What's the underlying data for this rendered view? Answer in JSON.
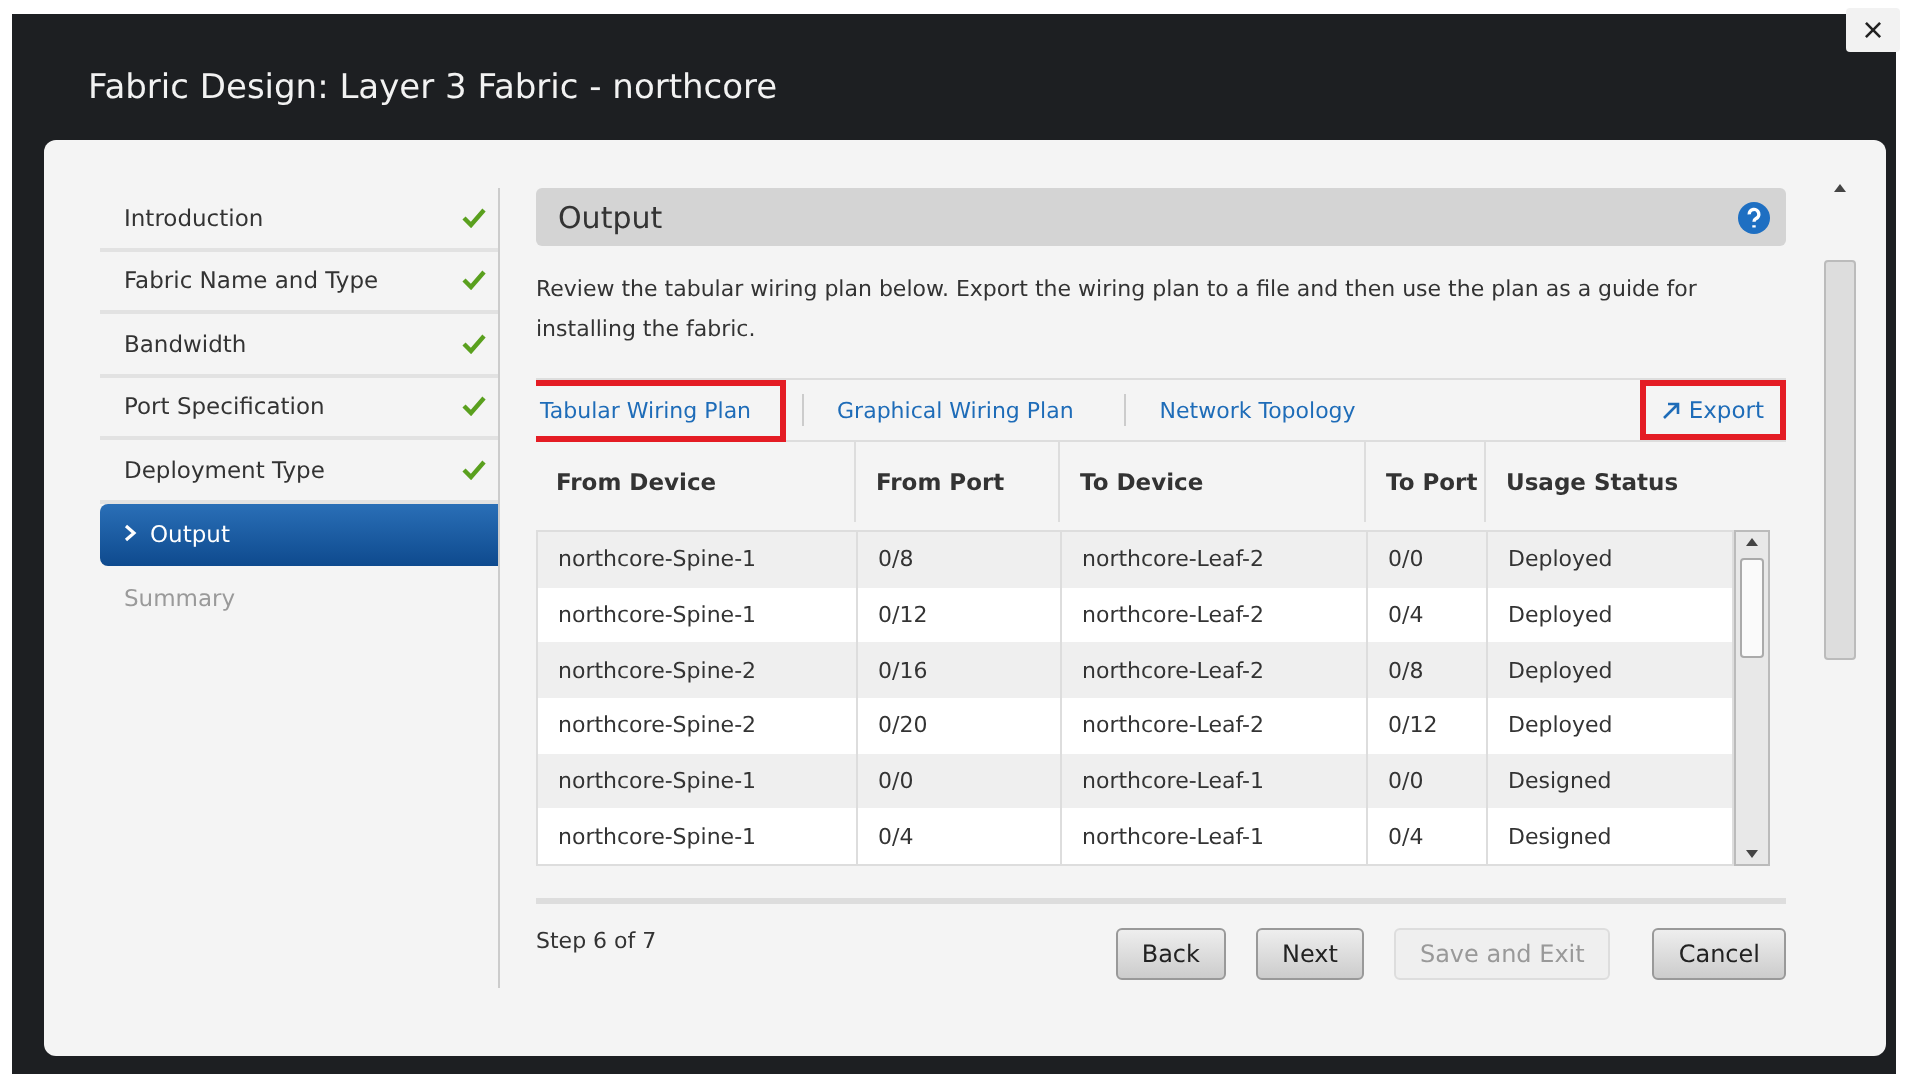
{
  "window": {
    "title": "Fabric Design: Layer 3 Fabric - northcore",
    "close": "×"
  },
  "sidebar": {
    "items": [
      {
        "label": "Introduction",
        "completed": true,
        "selected": false,
        "disabled": false
      },
      {
        "label": "Fabric Name and Type",
        "completed": true,
        "selected": false,
        "disabled": false
      },
      {
        "label": "Bandwidth",
        "completed": true,
        "selected": false,
        "disabled": false
      },
      {
        "label": "Port Specification",
        "completed": true,
        "selected": false,
        "disabled": false
      },
      {
        "label": "Deployment Type",
        "completed": true,
        "selected": false,
        "disabled": false
      },
      {
        "label": "Output",
        "completed": false,
        "selected": true,
        "disabled": false
      },
      {
        "label": "Summary",
        "completed": false,
        "selected": false,
        "disabled": true
      }
    ]
  },
  "section": {
    "title": "Output",
    "description": "Review the tabular wiring plan below. Export the wiring plan to a file and then use the plan as a guide for installing the fabric."
  },
  "tabs": [
    {
      "label": "Tabular Wiring Plan",
      "highlighted": true
    },
    {
      "label": "Graphical Wiring Plan",
      "highlighted": false
    },
    {
      "label": "Network Topology",
      "highlighted": false
    }
  ],
  "export": {
    "label": "Export",
    "highlighted": true
  },
  "table": {
    "columns": [
      "From Device",
      "From Port",
      "To Device",
      "To Port",
      "Usage Status"
    ],
    "rows": [
      [
        "northcore-Spine-1",
        "0/8",
        "northcore-Leaf-2",
        "0/0",
        "Deployed"
      ],
      [
        "northcore-Spine-1",
        "0/12",
        "northcore-Leaf-2",
        "0/4",
        "Deployed"
      ],
      [
        "northcore-Spine-2",
        "0/16",
        "northcore-Leaf-2",
        "0/8",
        "Deployed"
      ],
      [
        "northcore-Spine-2",
        "0/20",
        "northcore-Leaf-2",
        "0/12",
        "Deployed"
      ],
      [
        "northcore-Spine-1",
        "0/0",
        "northcore-Leaf-1",
        "0/0",
        "Designed"
      ],
      [
        "northcore-Spine-1",
        "0/4",
        "northcore-Leaf-1",
        "0/4",
        "Designed"
      ]
    ]
  },
  "footer": {
    "step": "Step 6 of 7",
    "buttons": [
      {
        "label": "Back",
        "disabled": false
      },
      {
        "label": "Next",
        "disabled": false
      },
      {
        "label": "Save and Exit",
        "disabled": true
      },
      {
        "label": "Cancel",
        "disabled": false
      }
    ]
  }
}
